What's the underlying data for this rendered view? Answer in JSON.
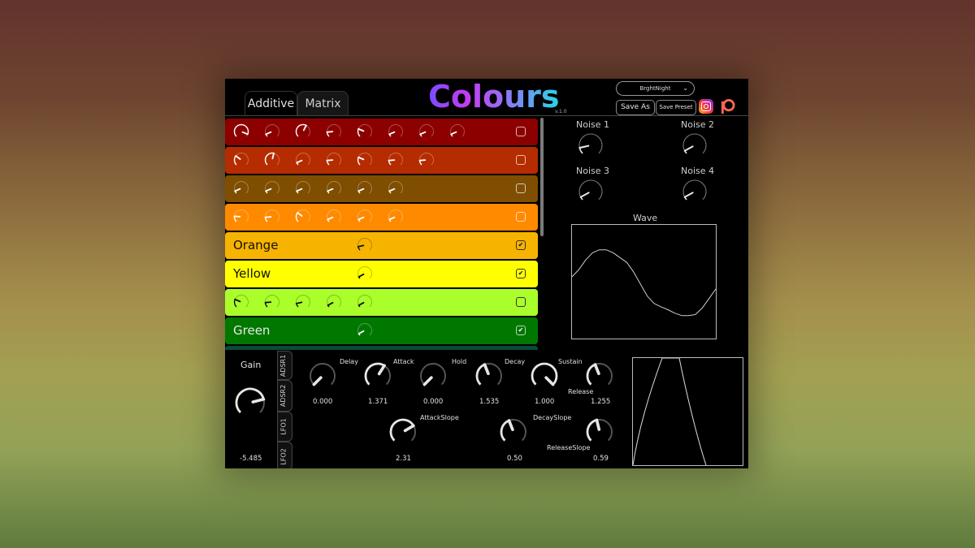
{
  "app": {
    "title": "Colours",
    "version": "v.1.0",
    "tabs": [
      {
        "label": "Additive",
        "active": true
      },
      {
        "label": "Matrix",
        "active": false
      }
    ],
    "preset": {
      "selected": "BrghtNight"
    },
    "buttons": {
      "save_as": "Save As",
      "save_preset": "Save Preset"
    },
    "social": [
      "instagram-icon",
      "patreon-icon"
    ]
  },
  "colors": {
    "title_gradient": [
      "#7a4cff",
      "#c33cf2",
      "#27d7e8"
    ],
    "background_top": "#62332d",
    "background_bottom": "#5f7b3d"
  },
  "rows": [
    {
      "name": "dark-red",
      "color": "#8c0000",
      "fg": "#ffffff",
      "label": "",
      "knobs": [
        0.92,
        0.08,
        0.6,
        0.15,
        0.25,
        0.08,
        0.08,
        0.08
      ],
      "checked": false
    },
    {
      "name": "red-orange",
      "color": "#b52c00",
      "fg": "#ffffff",
      "label": "",
      "knobs": [
        0.3,
        0.55,
        0.08,
        0.15,
        0.25,
        0.15,
        0.15
      ],
      "checked": false
    },
    {
      "name": "brown",
      "color": "#7f4e00",
      "fg": "#ffffff",
      "label": "",
      "knobs": [
        0.08,
        0.08,
        0.08,
        0.08,
        0.08,
        0.08
      ],
      "checked": false
    },
    {
      "name": "dark-orange",
      "color": "#ff8a00",
      "fg": "#ffffff",
      "label": "",
      "knobs": [
        0.18,
        0.15,
        0.3,
        0.08,
        0.08,
        0.08
      ],
      "checked": false
    },
    {
      "name": "orange",
      "color": "#f6b300",
      "fg": "#111111",
      "label": "Orange",
      "knobs": [
        0.12
      ],
      "knob_start": 4,
      "checked": true
    },
    {
      "name": "yellow",
      "color": "#ffff00",
      "fg": "#111111",
      "label": "Yellow",
      "knobs": [
        0.06
      ],
      "knob_start": 4,
      "checked": true
    },
    {
      "name": "lime",
      "color": "#aaff2a",
      "fg": "#111111",
      "label": "",
      "knobs": [
        0.25,
        0.15,
        0.12,
        0.06,
        0.06
      ],
      "checked": false
    },
    {
      "name": "green",
      "color": "#007800",
      "fg": "#ffffff",
      "label": "Green",
      "knobs": [
        0.06
      ],
      "knob_start": 4,
      "checked": true
    },
    {
      "name": "teal",
      "color": "#0a4a3a",
      "fg": "#ffffff",
      "label": "",
      "knobs": [],
      "checked": false
    }
  ],
  "noise": [
    {
      "label": "Noise 1",
      "value": 0.12
    },
    {
      "label": "Noise 2",
      "value": 0.06
    },
    {
      "label": "Noise 3",
      "value": 0.06
    },
    {
      "label": "Noise 4",
      "value": 0.06
    }
  ],
  "wave": {
    "label": "Wave",
    "samples": [
      0.1,
      0.25,
      0.45,
      0.6,
      0.66,
      0.66,
      0.6,
      0.5,
      0.4,
      0.2,
      -0.05,
      -0.3,
      -0.45,
      -0.52,
      -0.58,
      -0.65,
      -0.7,
      -0.7,
      -0.68,
      -0.55,
      -0.35,
      -0.15
    ]
  },
  "gain": {
    "label": "Gain",
    "value": "-5.485",
    "position": 0.78
  },
  "side_tabs": [
    "ADSR1",
    "ADSR2",
    "LFO1",
    "LFO2"
  ],
  "adsr": {
    "params": [
      {
        "name": "delay",
        "label": "Delay",
        "value": "0.000",
        "position": 0.0
      },
      {
        "name": "attack",
        "label": "Attack",
        "value": "1.371",
        "position": 0.62
      },
      {
        "name": "hold",
        "label": "Hold",
        "value": "0.000",
        "position": 0.0
      },
      {
        "name": "decay",
        "label": "Decay",
        "value": "1.535",
        "position": 0.42
      },
      {
        "name": "sustain",
        "label": "Sustain",
        "value": "1.000",
        "position": 1.0
      },
      {
        "name": "release",
        "label": "Release",
        "value": "1.255",
        "position": 0.42
      }
    ],
    "slopes": [
      {
        "name": "attack-slope",
        "label": "AttackSlope",
        "value": "2.31",
        "position": 0.72
      },
      {
        "name": "decay-slope",
        "label": "DecaySlope",
        "value": "0.50",
        "position": 0.42
      },
      {
        "name": "release-slope",
        "label": "ReleaseSlope",
        "value": "0.59",
        "position": 0.45
      }
    ]
  }
}
